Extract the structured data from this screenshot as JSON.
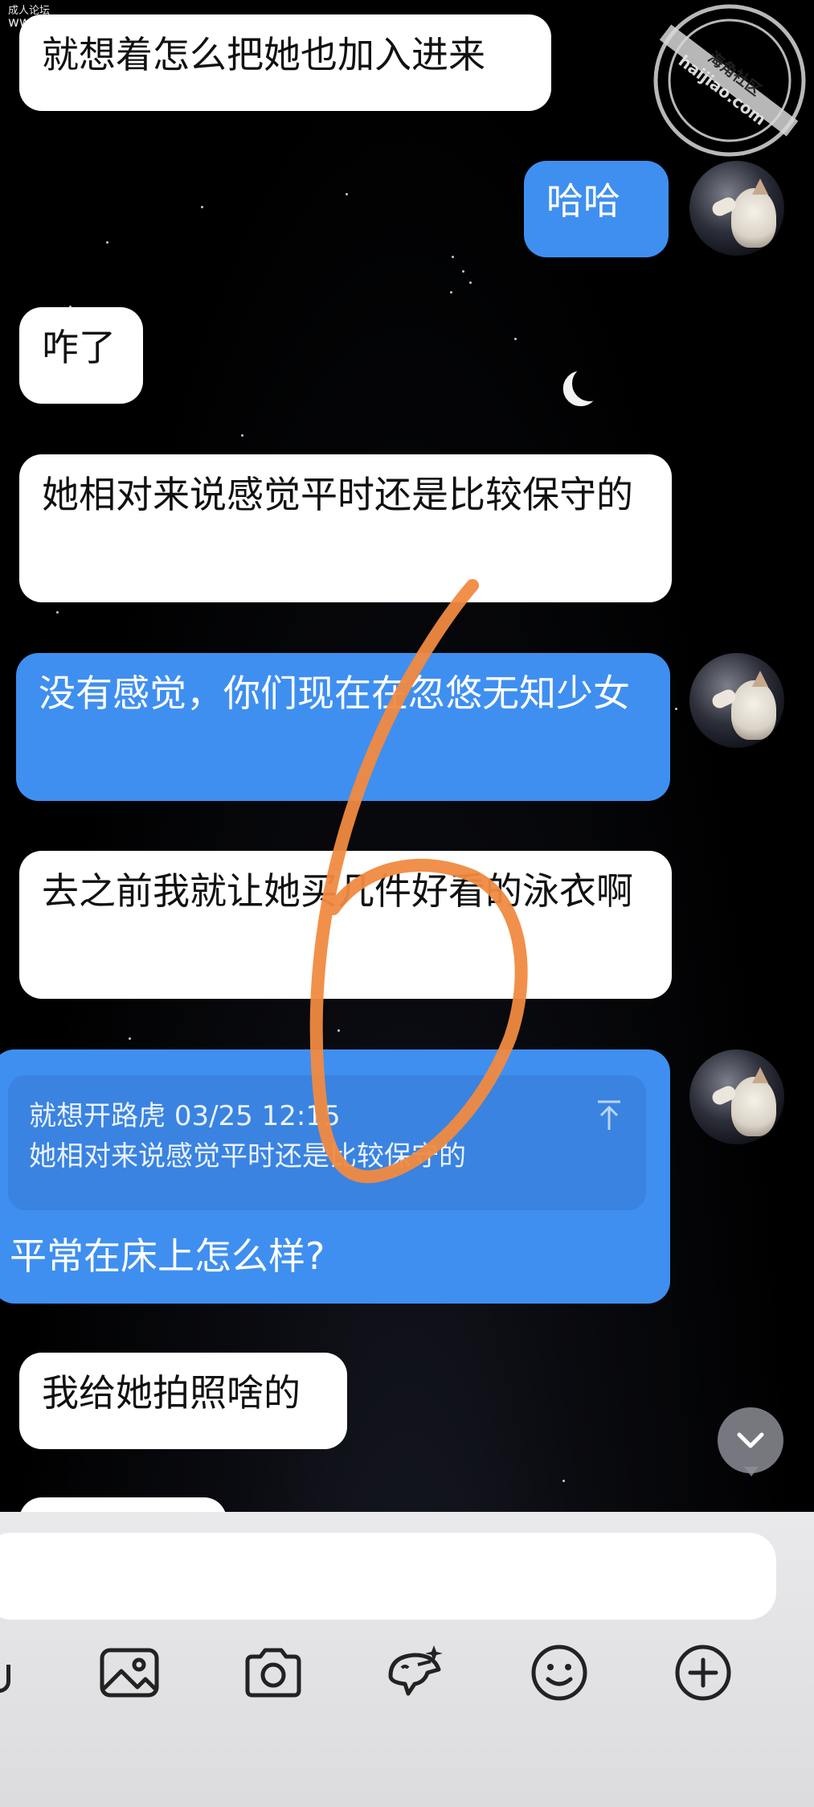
{
  "watermarks": {
    "top_left_line1": "成人论坛",
    "top_left_line2": "www.v43d.com",
    "seal_text_cn": "海角社区",
    "seal_text_en": "haijiao.com"
  },
  "messages": [
    {
      "id": "m1",
      "side": "in",
      "text": "就想着怎么把她也加入进来"
    },
    {
      "id": "m2",
      "side": "out",
      "text": "哈哈"
    },
    {
      "id": "m3",
      "side": "in",
      "text": "咋了"
    },
    {
      "id": "m4",
      "side": "in",
      "text": "她相对来说感觉平时还是比较保守的"
    },
    {
      "id": "m5",
      "side": "out",
      "text": "没有感觉，你们现在在忽悠无知少女"
    },
    {
      "id": "m6",
      "side": "in",
      "text": "去之前我就让她买几件好看的泳衣啊"
    },
    {
      "id": "m7",
      "side": "out",
      "text": "平常在床上怎么样?"
    },
    {
      "id": "m8",
      "side": "in",
      "text": "我给她拍照啥的"
    }
  ],
  "quote": {
    "sender": "就想开路虎",
    "timestamp": "03/25 12:15",
    "text": "她相对来说感觉平时还是比较保守的"
  },
  "composer": {
    "input_value": "",
    "tools": [
      "image-icon",
      "camera-icon",
      "sticker-icon",
      "emoji-icon",
      "plus-icon"
    ]
  },
  "colors": {
    "outgoing_bubble": "#3f8ff0",
    "incoming_bubble": "#ffffff",
    "quote_box": "#3a83e0",
    "annotation_stroke": "#f08a40"
  }
}
